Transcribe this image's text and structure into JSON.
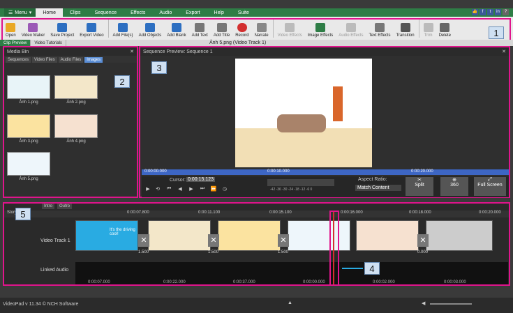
{
  "menu": {
    "label": "Menu",
    "tabs": [
      "Home",
      "Clips",
      "Sequence",
      "Effects",
      "Audio",
      "Export",
      "Help",
      "Suite"
    ]
  },
  "toolbar": {
    "items": [
      "Open",
      "Video Maker",
      "Save Project",
      "Export Video",
      "Add File(s)",
      "Add Objects",
      "Add Blank",
      "Add Text",
      "Add Title",
      "Record",
      "Narrate",
      "Video Effects",
      "Image Effects",
      "Audio Effects",
      "Text Effects",
      "Transition",
      "Trim",
      "Delete"
    ]
  },
  "subtabs": [
    "Clip Preview",
    "Video Tutorials"
  ],
  "selected_name": "Ảnh 5.png (Video Track 1)",
  "bin": {
    "title": "Media Bin",
    "tabs": [
      "Sequences",
      "Video Files",
      "Audio Files",
      "Images"
    ],
    "items": [
      "Ảnh 1.png",
      "Ảnh 2.png",
      "Ảnh 3.png",
      "Ảnh 4.png",
      "Ảnh 5.png"
    ]
  },
  "preview": {
    "title": "Sequence Preview: Sequence 1",
    "times": [
      "0:00:00.000",
      "0:00:10.000",
      "0:00:20.000"
    ],
    "cursor_label": "Cursor:",
    "cursor": "0:00:15.123",
    "meter": "-42 -36 -30 -24 -18 -12 -6 0",
    "aspect_label": "Aspect Ratio:",
    "aspect": "Match Content",
    "split": "Split",
    "three60": "360",
    "fullscreen": "Full Screen"
  },
  "timeline": {
    "tabs": [
      "Intro",
      "Outro"
    ],
    "storyboard": "Storyboard",
    "ruler": [
      "0:00:07.800",
      "0:00:11.100",
      "0:00:15.100",
      "0:00:16.000",
      "0:00:18.000",
      "0:00:20.000"
    ],
    "video_track": "Video Track 1",
    "audio_track": "Linked Audio",
    "trans": [
      "1.500",
      "1.500",
      "1.500",
      "0.000"
    ],
    "audio_times": [
      "0:00:07.000",
      "0:00:22.000",
      "0:00:37.000",
      "0:00:00.000",
      "0:00:02.000",
      "0:00:03.000"
    ],
    "clip_text": "It's the driving cool!"
  },
  "callouts": [
    "1",
    "2",
    "3",
    "4",
    "5"
  ],
  "status": "VideoPad v 11.34 © NCH Software"
}
